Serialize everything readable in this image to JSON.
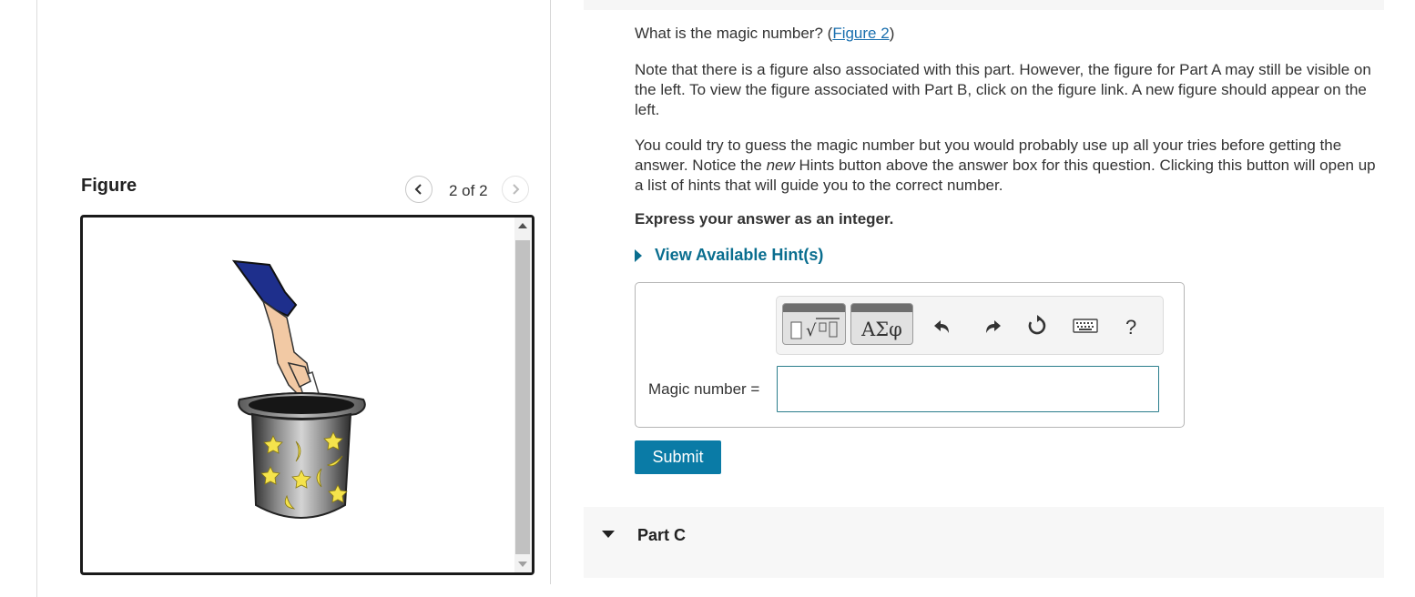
{
  "figure_panel": {
    "title": "Figure",
    "counter": "2 of 2",
    "prev_icon": "chevron-left-icon",
    "next_icon": "chevron-right-icon",
    "image_alt": "magic hat with hand holding a slip of paper"
  },
  "question": {
    "prefix": "What is the magic number? (",
    "figure_link": "Figure 2",
    "suffix": ")",
    "note": "Note that there is a figure also associated with this part. However, the figure for Part A may still be visible on the left. To view the figure associated with Part B, click on the figure link. A new figure should appear on the left.",
    "guess_before": "You could try to guess the magic number but you would probably use up all your tries before getting the answer. Notice the ",
    "guess_em": "new",
    "guess_after": " Hints button above the answer box for this question. Clicking this button will open up a list of hints that will guide you to the correct number.",
    "express": "Express your answer as an integer.",
    "hints_label": "View Available Hint(s)"
  },
  "toolbar": {
    "templates_icon": "math-templates-icon",
    "greek_label": "ΑΣφ",
    "undo_icon": "undo-icon",
    "redo_icon": "redo-icon",
    "reset_icon": "reset-icon",
    "keyboard_icon": "keyboard-icon",
    "help_label": "?"
  },
  "answer": {
    "label": "Magic number =",
    "value": ""
  },
  "submit_label": "Submit",
  "part_c_label": "Part C",
  "colors": {
    "accent": "#0a7ba6",
    "link": "#1a6fae",
    "hint": "#0a6e8f"
  }
}
